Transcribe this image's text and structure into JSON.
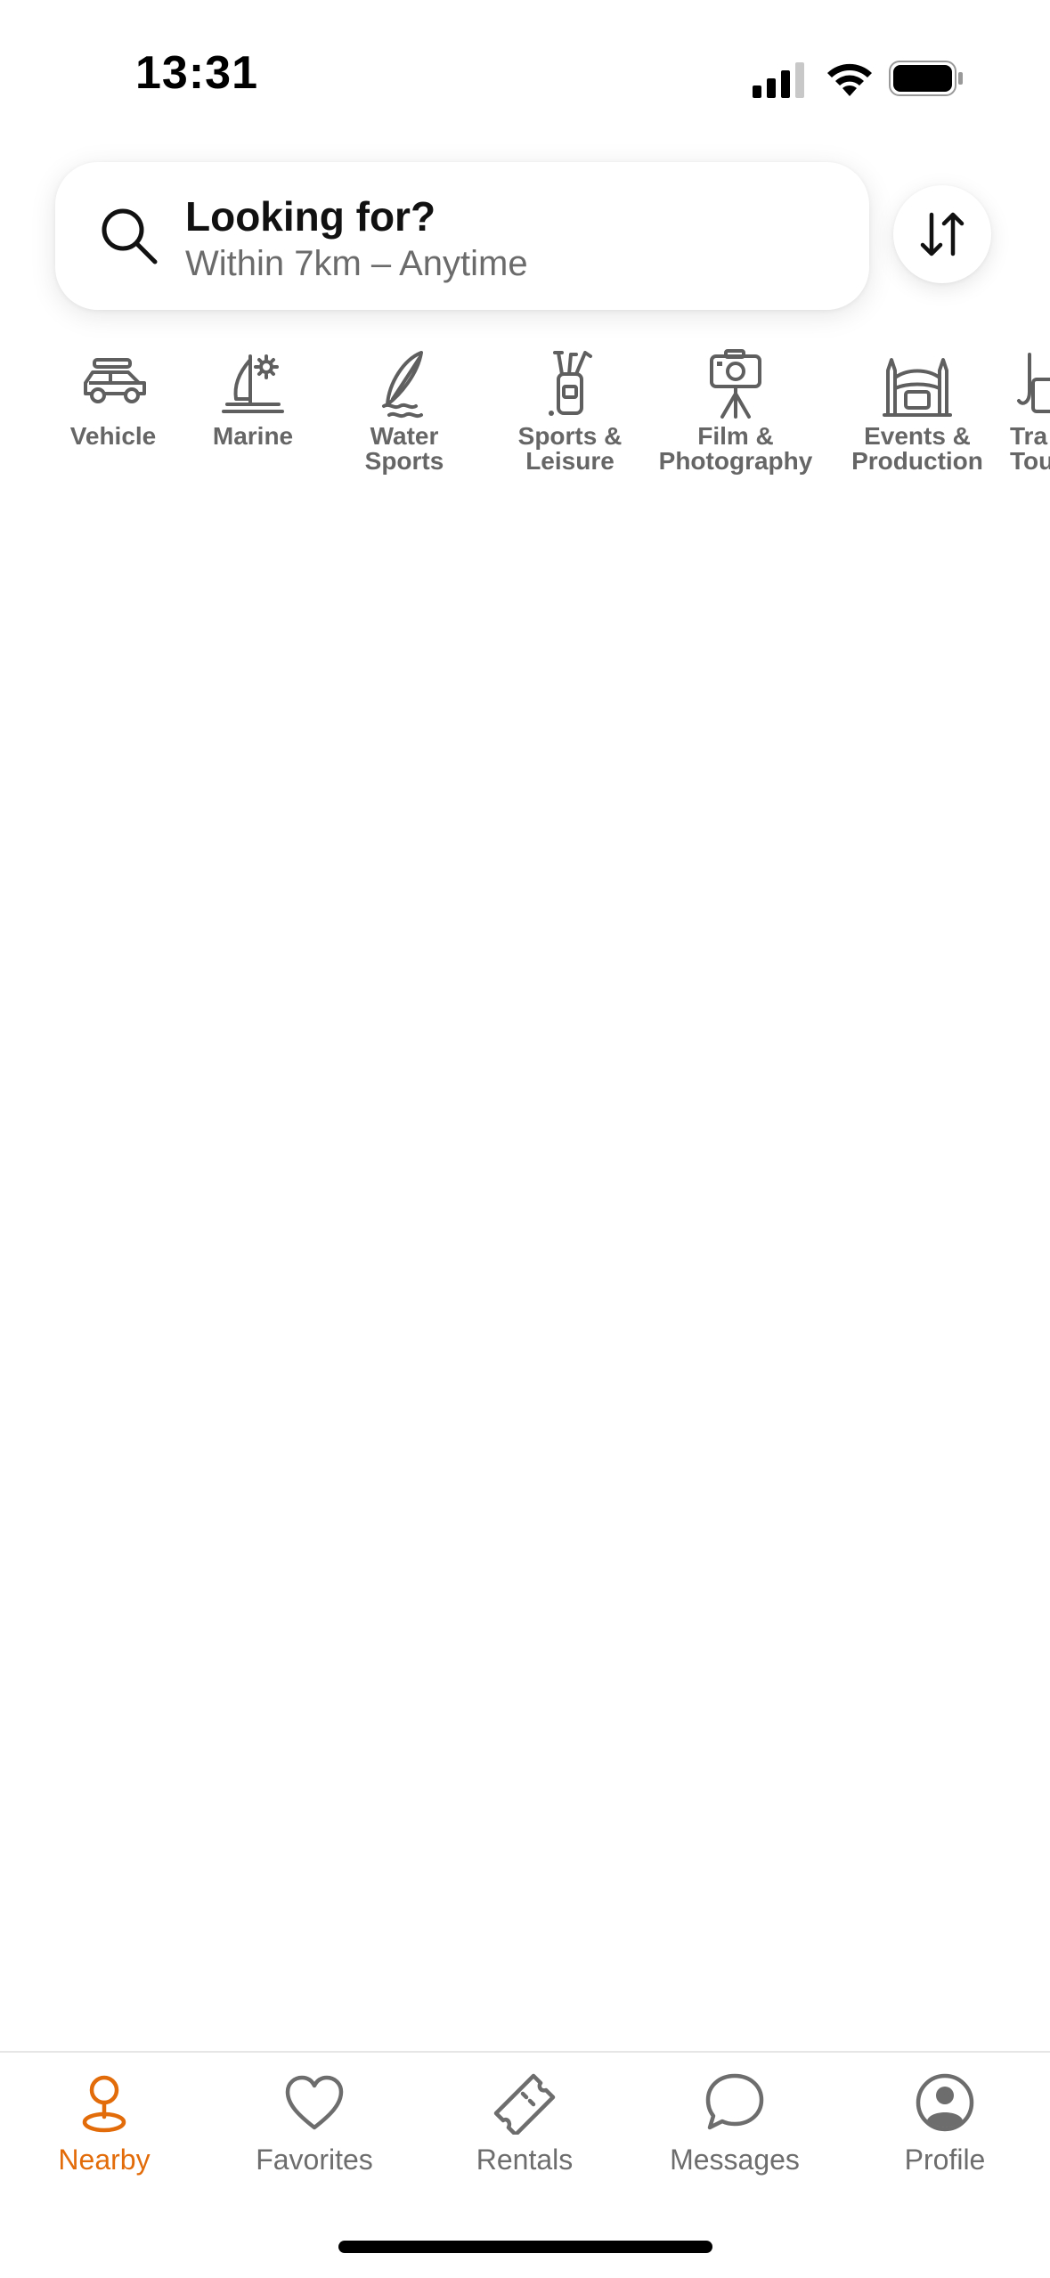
{
  "status": {
    "time": "13:31"
  },
  "search": {
    "title": "Looking for?",
    "subtitle": "Within 7km – Anytime"
  },
  "categories": [
    {
      "icon": "car-icon",
      "label": "Vehicle"
    },
    {
      "icon": "sailboat-icon",
      "label": "Marine"
    },
    {
      "icon": "surfboard-icon",
      "label": "Water\nSports"
    },
    {
      "icon": "golf-bag-icon",
      "label": "Sports &\nLeisure"
    },
    {
      "icon": "camera-tripod-icon",
      "label": "Film &\nPhotography"
    },
    {
      "icon": "bounce-castle-icon",
      "label": "Events &\nProduction"
    },
    {
      "icon": "luggage-icon",
      "label": "Tra\nTou"
    }
  ],
  "nav": {
    "tabs": [
      {
        "icon": "map-pin-icon",
        "label": "Nearby",
        "active": true
      },
      {
        "icon": "heart-icon",
        "label": "Favorites",
        "active": false
      },
      {
        "icon": "ticket-icon",
        "label": "Rentals",
        "active": false
      },
      {
        "icon": "chat-bubble-icon",
        "label": "Messages",
        "active": false
      },
      {
        "icon": "profile-icon",
        "label": "Profile",
        "active": false
      }
    ]
  },
  "colors": {
    "accent": "#e36c0a",
    "icon_gray": "#5f5f5f",
    "text_gray": "#6d6d6d"
  }
}
